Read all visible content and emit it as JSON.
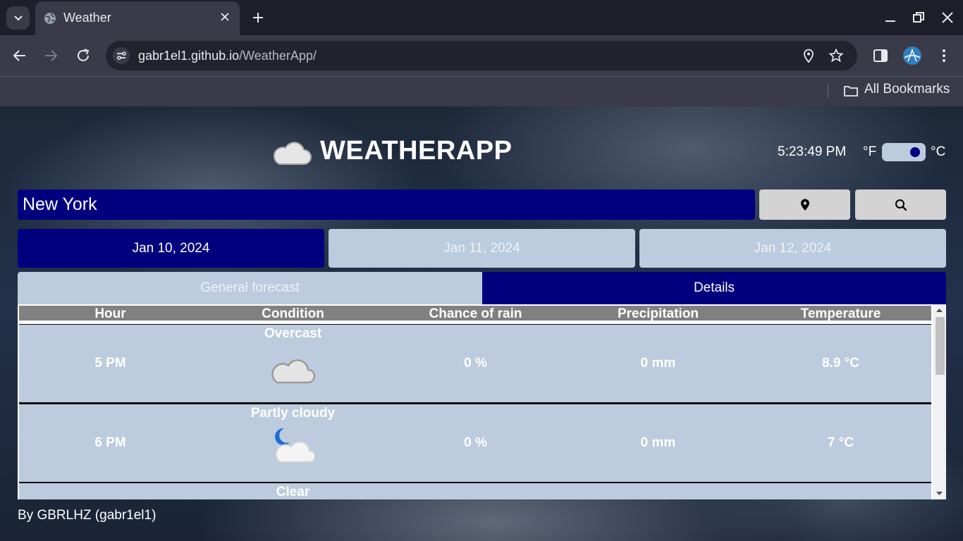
{
  "browser": {
    "tab_title": "Weather",
    "url_host": "gabr1el1.github.io",
    "url_path": "/WeatherApp/",
    "bookmarks_label": "All Bookmarks"
  },
  "app": {
    "title": "WEATHERAPP",
    "clock": "5:23:49 PM",
    "unit_f": "°F",
    "unit_c": "°C",
    "unit_selected": "°C",
    "search_value": "New York",
    "day_tabs": [
      {
        "label": "Jan 10, 2024",
        "active": true
      },
      {
        "label": "Jan 11, 2024",
        "active": false
      },
      {
        "label": "Jan 12, 2024",
        "active": false
      }
    ],
    "view_tabs": [
      {
        "label": "General forecast",
        "active": false
      },
      {
        "label": "Details",
        "active": true
      }
    ],
    "table": {
      "headers": [
        "Hour",
        "Condition",
        "Chance of rain",
        "Precipitation",
        "Temperature"
      ],
      "rows": [
        {
          "hour": "5 PM",
          "condition": "Overcast",
          "icon": "cloud-icon",
          "rain": "0 %",
          "precip": "0 mm",
          "temp": "8.9 °C"
        },
        {
          "hour": "6 PM",
          "condition": "Partly cloudy",
          "icon": "moon-cloud-icon",
          "rain": "0 %",
          "precip": "0 mm",
          "temp": "7 °C"
        },
        {
          "hour": "",
          "condition": "Clear",
          "icon": "",
          "rain": "",
          "precip": "",
          "temp": ""
        }
      ]
    },
    "footer": "By GBRLHZ (gabr1el1)",
    "colors": {
      "accent": "#00007f",
      "inactive": "#bccbde",
      "header_gray": "#808080"
    }
  }
}
